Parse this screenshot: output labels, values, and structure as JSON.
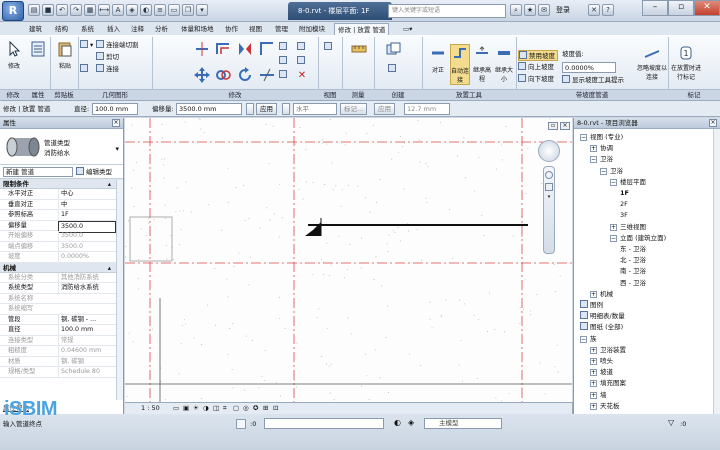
{
  "window": {
    "app_initial": "R",
    "doc_title": "8-0.rvt - 楼层平面: 1F",
    "search_placeholder": "键入关键字或短语",
    "login": "登录",
    "help": "?"
  },
  "tabs": [
    "建筑",
    "结构",
    "系统",
    "插入",
    "注释",
    "分析",
    "体量和场地",
    "协作",
    "视图",
    "管理",
    "附加模块",
    "修改 | 放置 管道"
  ],
  "ribbon": {
    "modify": "修改",
    "select": "选择",
    "paste": "粘贴",
    "join_cut": "连接端切割",
    "cut": "剪切",
    "join": "连接",
    "clipboard": "剪贴板",
    "geometry": "几何图形",
    "modify_panel": "修改",
    "view_panel": "视图",
    "measure": "测量",
    "create": "创建",
    "align": "对正",
    "auto_connect": "自动连接",
    "inherit_elev": "继承高程",
    "inherit_size": "继承大小",
    "slope_down": "禁用坡度",
    "slope_up": "向上坡度",
    "slope_dn": "向下坡度",
    "slope_value_label": "坡度值:",
    "slope_value": "0.0000%",
    "show_slope_tip": "显示坡度工具提示",
    "ignore_slope": "忽略坡度以连接",
    "tag_on_place": "在放置时进行标记",
    "placement_tools": "放置工具",
    "slope_tools": "带坡度管道",
    "tag": "标记"
  },
  "options_bar": {
    "context": "修改 | 放置 管道",
    "diameter_label": "直径:",
    "diameter": "100.0 mm",
    "offset_label": "偏移量:",
    "offset": "3500.0 mm",
    "apply": "应用",
    "horizontal": "水平",
    "mark": "标记...",
    "apply2": "应用",
    "size": "12.7 mm"
  },
  "properties": {
    "header": "属性",
    "type_family": "管道类型",
    "type_name": "消防给水",
    "instance_select": "新建 管道",
    "edit_type": "编辑类型",
    "groups": [
      {
        "name": "限制条件",
        "rows": [
          {
            "k": "水平对正",
            "v": "中心",
            "dim": false
          },
          {
            "k": "垂直对正",
            "v": "中",
            "dim": false
          },
          {
            "k": "参照标高",
            "v": "1F",
            "dim": false
          },
          {
            "k": "偏移量",
            "v": "3500.0",
            "dim": false
          },
          {
            "k": "开始偏移",
            "v": "3500.0",
            "dim": true
          },
          {
            "k": "端点偏移",
            "v": "3500.0",
            "dim": true
          },
          {
            "k": "坡度",
            "v": "0.0000%",
            "dim": true
          }
        ]
      },
      {
        "name": "机械",
        "rows": [
          {
            "k": "系统分类",
            "v": "其他消防系统",
            "dim": true
          },
          {
            "k": "系统类型",
            "v": "消防给水系统",
            "dim": false
          },
          {
            "k": "系统名称",
            "v": "",
            "dim": true
          },
          {
            "k": "系统缩写",
            "v": "",
            "dim": true
          },
          {
            "k": "管段",
            "v": "钢, 碳钢 - ...",
            "dim": false
          },
          {
            "k": "直径",
            "v": "100.0 mm",
            "dim": false
          },
          {
            "k": "连接类型",
            "v": "常规",
            "dim": true
          },
          {
            "k": "粗糙度",
            "v": "0.04600 mm",
            "dim": true
          },
          {
            "k": "材质",
            "v": "钢, 碳钢",
            "dim": true
          },
          {
            "k": "规格/类型",
            "v": "Schedule 80",
            "dim": true
          }
        ]
      }
    ],
    "help": "属性帮助"
  },
  "viewbar": {
    "scale": "1 : 50"
  },
  "browser": {
    "header": "8-0.rvt - 项目浏览器",
    "items": [
      {
        "label": "视图 (专业)",
        "level": 0,
        "pm": "-"
      },
      {
        "label": "协调",
        "level": 1,
        "pm": "+"
      },
      {
        "label": "卫浴",
        "level": 1,
        "pm": "-"
      },
      {
        "label": "卫浴",
        "level": 2,
        "pm": "-"
      },
      {
        "label": "楼层平面",
        "level": 3,
        "pm": "-"
      },
      {
        "label": "1F",
        "level": 4,
        "pm": ""
      },
      {
        "label": "2F",
        "level": 4,
        "pm": ""
      },
      {
        "label": "3F",
        "level": 4,
        "pm": ""
      },
      {
        "label": "三维视图",
        "level": 3,
        "pm": "+"
      },
      {
        "label": "立面 (建筑立面)",
        "level": 3,
        "pm": "-"
      },
      {
        "label": "东 - 卫浴",
        "level": 4,
        "pm": ""
      },
      {
        "label": "北 - 卫浴",
        "level": 4,
        "pm": ""
      },
      {
        "label": "南 - 卫浴",
        "level": 4,
        "pm": ""
      },
      {
        "label": "西 - 卫浴",
        "level": 4,
        "pm": ""
      },
      {
        "label": "机械",
        "level": 1,
        "pm": "+"
      },
      {
        "label": "图例",
        "level": 0,
        "pm": ""
      },
      {
        "label": "明细表/数量",
        "level": 0,
        "pm": ""
      },
      {
        "label": "图纸 (全部)",
        "level": 0,
        "pm": ""
      },
      {
        "label": "族",
        "level": 0,
        "pm": "-"
      },
      {
        "label": "卫浴装置",
        "level": 1,
        "pm": "+"
      },
      {
        "label": "喷头",
        "level": 1,
        "pm": "+"
      },
      {
        "label": "坡道",
        "level": 1,
        "pm": "+"
      },
      {
        "label": "填充图案",
        "level": 1,
        "pm": "+"
      },
      {
        "label": "墙",
        "level": 1,
        "pm": "+"
      },
      {
        "label": "天花板",
        "level": 1,
        "pm": "+"
      }
    ]
  },
  "status": {
    "message": "输入管道终点",
    "zero": ":0",
    "model": "主模型",
    "watermark": "iSBIM"
  }
}
